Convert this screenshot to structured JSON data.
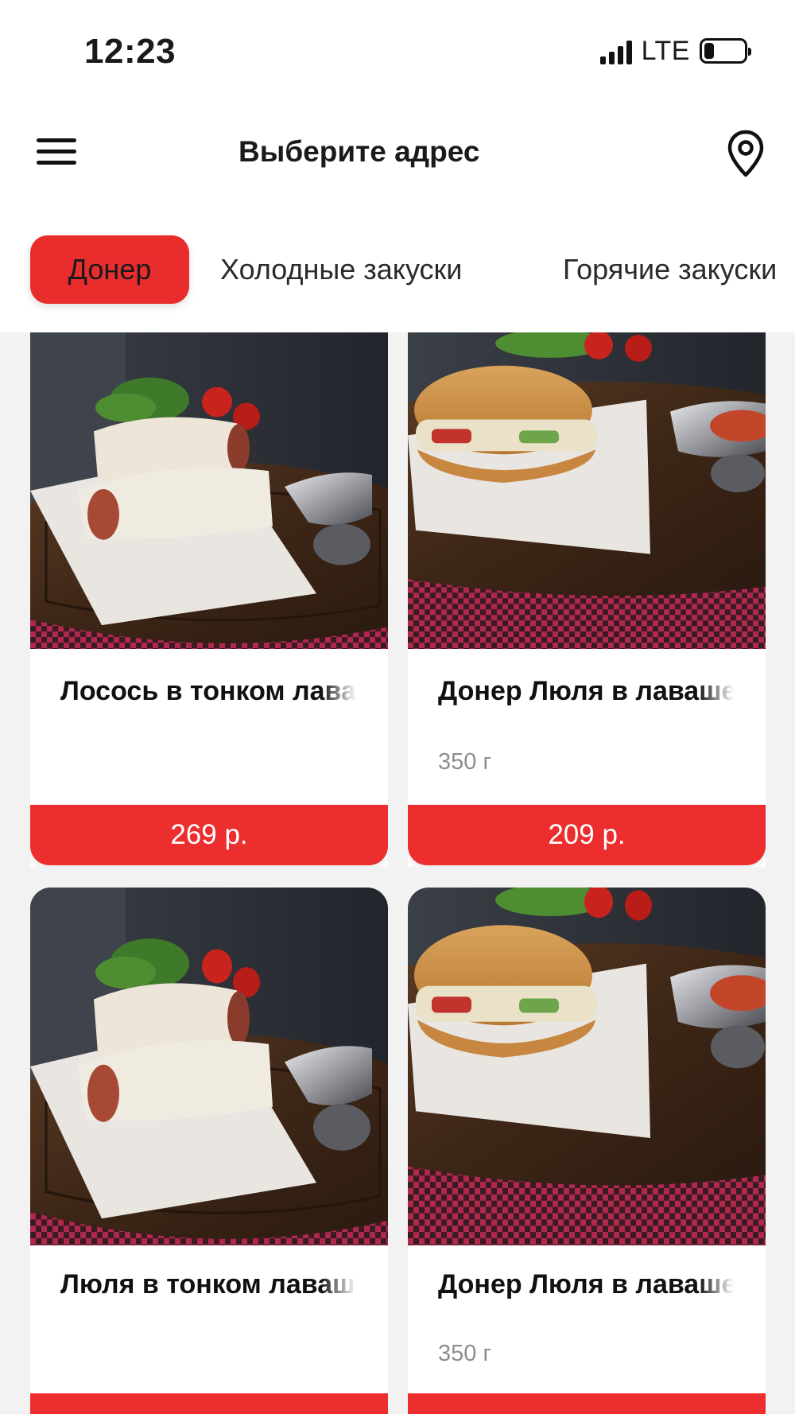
{
  "status_bar": {
    "time": "12:23",
    "network": "LTE",
    "battery_level": 0.2
  },
  "header": {
    "title": "Выберите адрес"
  },
  "categories": [
    {
      "label": "Донер",
      "active": true
    },
    {
      "label": "Холодные закуски",
      "active": false
    },
    {
      "label": "Горячие закуски",
      "active": false
    }
  ],
  "products": [
    {
      "name": "Лосось в тонком лаваше",
      "weight": "",
      "price": "269 р.",
      "image": "wrap-halves-photo"
    },
    {
      "name": "Донер Люля в лаваше",
      "weight": "350 г",
      "price": "209 р.",
      "image": "doner-bread-photo"
    },
    {
      "name": "Люля в тонком лаваше",
      "weight": "",
      "price": "",
      "image": "wrap-halves-photo"
    },
    {
      "name": "Донер Люля в лаваше",
      "weight": "350 г",
      "price": "",
      "image": "doner-bread-photo"
    }
  ],
  "colors": {
    "accent": "#ec2e2e",
    "background": "#f2f2f2",
    "muted_text": "#8d8d8d"
  }
}
